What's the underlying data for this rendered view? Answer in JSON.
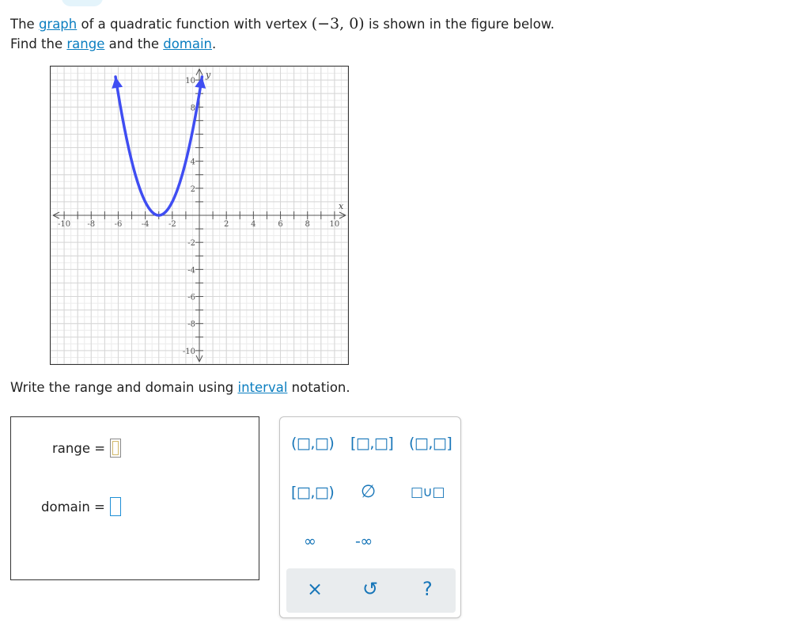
{
  "question": {
    "part1": "The ",
    "link_graph": "graph",
    "part2": " of a quadratic function with vertex ",
    "vertex": "(−3, 0)",
    "part3": " is shown in the figure below.",
    "line2_part1": "Find the ",
    "link_range": "range",
    "line2_part2": " and the ",
    "link_domain": "domain",
    "line2_part3": "."
  },
  "graph": {
    "x_axis_label": "x",
    "y_axis_label": "y",
    "x_tick_labels": [
      "-10",
      "-8",
      "-6",
      "-4",
      "-2",
      "2",
      "4",
      "6",
      "8",
      "10"
    ],
    "y_tick_labels": [
      "10",
      "8",
      "4",
      "2",
      "-2",
      "-4",
      "-6",
      "-8",
      "-10"
    ],
    "curve_color": "#3f4df2",
    "vertex": [
      -3,
      0
    ],
    "function": "y = (x + 3)^2",
    "x_range": [
      -6.2,
      0.2
    ]
  },
  "prompt2": {
    "part1": "Write the range and domain using ",
    "link_interval": "interval",
    "part2": " notation."
  },
  "answers": {
    "range_label": "range =",
    "domain_label": "domain ="
  },
  "keypad": {
    "open_open": "(□,□)",
    "closed_closed": "[□,□]",
    "open_closed": "(□,□]",
    "closed_open": "[□,□)",
    "empty_set": "∅",
    "union": "□∪□",
    "infinity": "∞",
    "neg_infinity": "-∞",
    "clear": "×",
    "undo": "↺",
    "help": "?"
  }
}
